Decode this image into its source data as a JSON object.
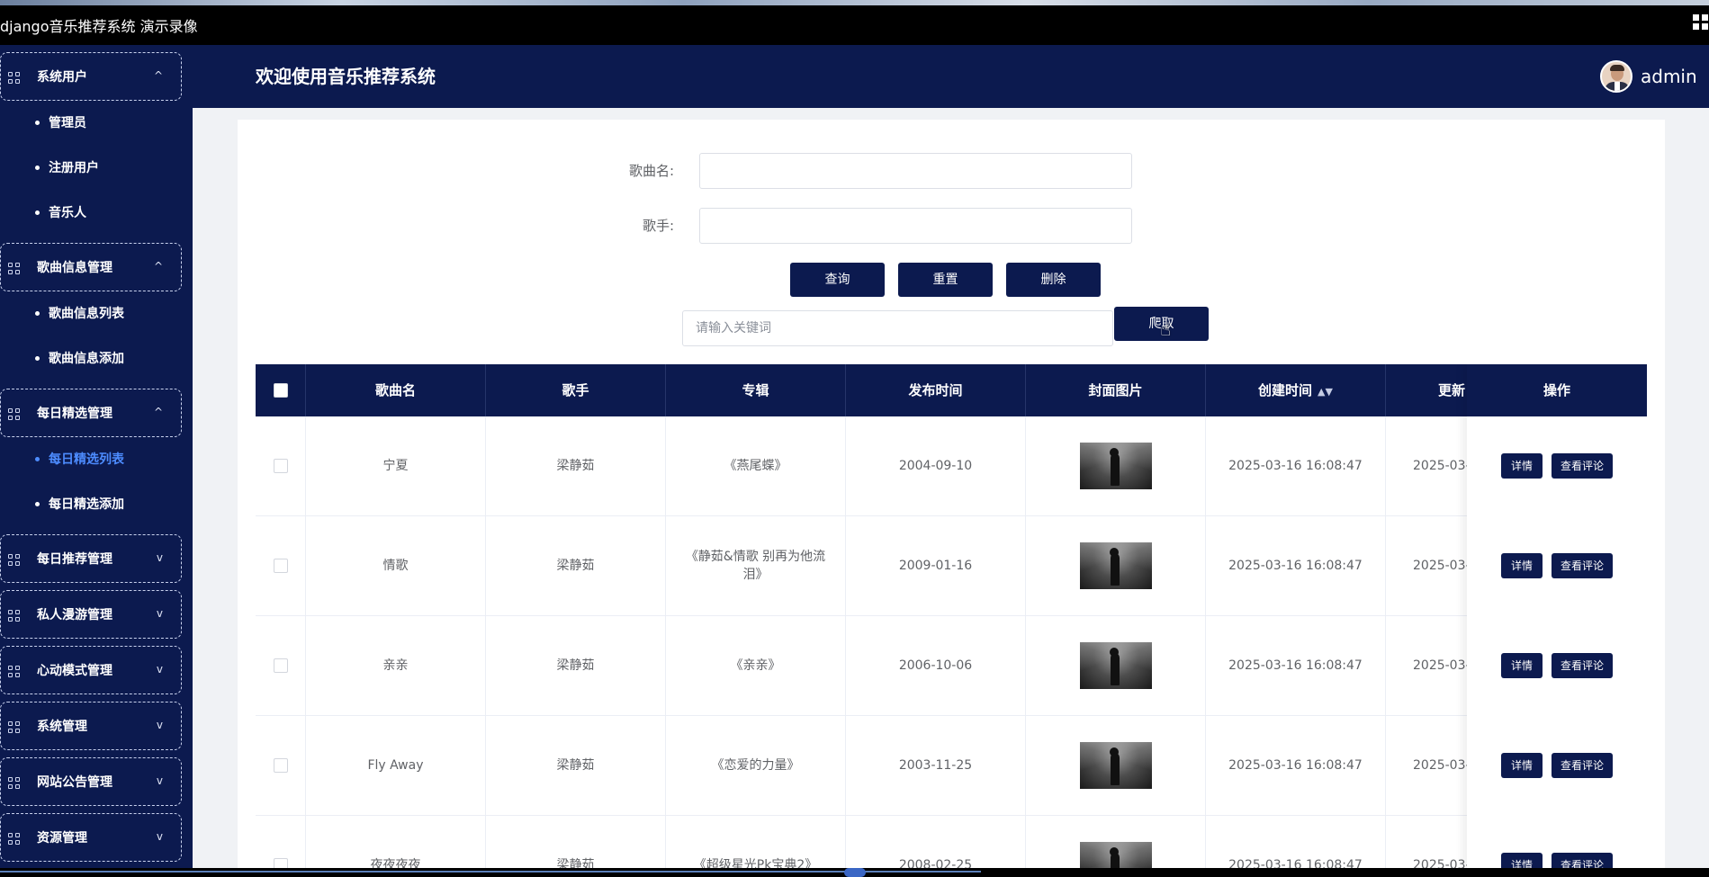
{
  "window": {
    "title": "django音乐推荐系统 演示录像"
  },
  "header": {
    "welcome": "欢迎使用音乐推荐系统",
    "username": "admin"
  },
  "sidebar": {
    "groups": [
      {
        "label": "系统用户",
        "chevron": "^",
        "children": [
          "管理员",
          "注册用户",
          "音乐人"
        ]
      },
      {
        "label": "歌曲信息管理",
        "chevron": "^",
        "children": [
          "歌曲信息列表",
          "歌曲信息添加"
        ]
      },
      {
        "label": "每日精选管理",
        "chevron": "^",
        "children": [
          "每日精选列表",
          "每日精选添加"
        ],
        "active_child": "每日精选列表"
      },
      {
        "label": "每日推荐管理",
        "chevron": "v"
      },
      {
        "label": "私人漫游管理",
        "chevron": "v"
      },
      {
        "label": "心动模式管理",
        "chevron": "v"
      },
      {
        "label": "系统管理",
        "chevron": "v"
      },
      {
        "label": "网站公告管理",
        "chevron": "v"
      },
      {
        "label": "资源管理",
        "chevron": "v"
      }
    ]
  },
  "search": {
    "song_label": "歌曲名:",
    "song_value": "",
    "singer_label": "歌手:",
    "singer_value": "",
    "query_btn": "查询",
    "reset_btn": "重置",
    "delete_btn": "删除",
    "keyword_placeholder": "请输入关键词",
    "crawl_btn": "爬取"
  },
  "table": {
    "columns": [
      "歌曲名",
      "歌手",
      "专辑",
      "发布时间",
      "封面图片",
      "创建时间",
      "更新",
      "操作"
    ],
    "sort_icon": "sort-icon",
    "detail_btn": "详情",
    "comment_btn": "查看评论",
    "rows": [
      {
        "song": "宁夏",
        "singer": "梁静茹",
        "album": "《燕尾蝶》",
        "release": "2004-09-10",
        "created": "2025-03-16 16:08:47",
        "updated": "2025-03-"
      },
      {
        "song": "情歌",
        "singer": "梁静茹",
        "album": "《静茹&情歌 别再为他流泪》",
        "release": "2009-01-16",
        "created": "2025-03-16 16:08:47",
        "updated": "2025-03-"
      },
      {
        "song": "亲亲",
        "singer": "梁静茹",
        "album": "《亲亲》",
        "release": "2006-10-06",
        "created": "2025-03-16 16:08:47",
        "updated": "2025-03-"
      },
      {
        "song": "Fly Away",
        "singer": "梁静茹",
        "album": "《恋爱的力量》",
        "release": "2003-11-25",
        "created": "2025-03-16 16:08:47",
        "updated": "2025-03-"
      },
      {
        "song": "夜夜夜夜",
        "singer": "梁静茹",
        "album": "《超级星光Pk宝典2》",
        "release": "2008-02-25",
        "created": "2025-03-16 16:08:47",
        "updated": "2025-03-"
      }
    ]
  },
  "colors": {
    "primary": "#0c1a4f",
    "active": "#4d8cff",
    "background": "#f0f2f5"
  }
}
